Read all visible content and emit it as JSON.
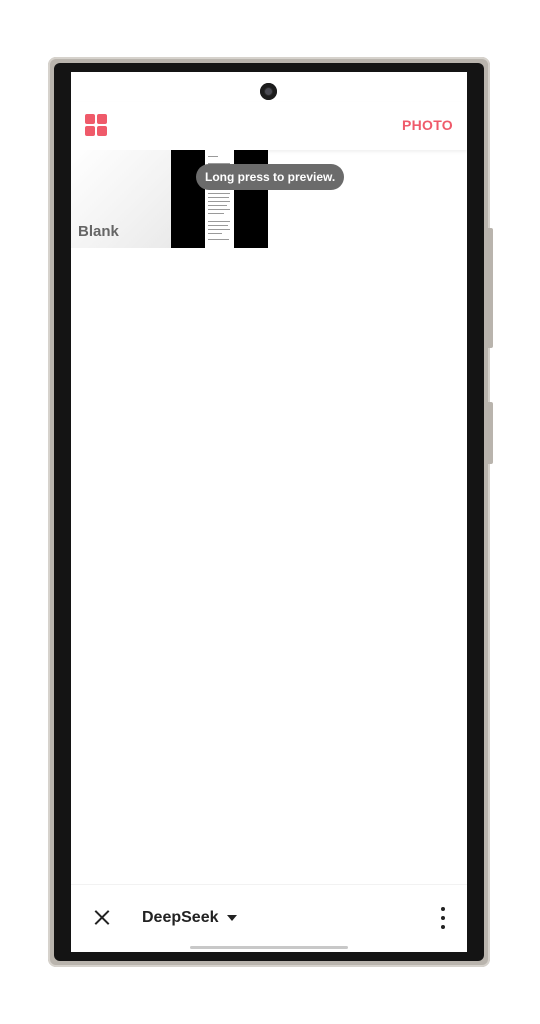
{
  "header": {
    "menu_icon": "grid-icon",
    "photo_label": "PHOTO",
    "accent_color": "#ef5a6a"
  },
  "templates": [
    {
      "label": "Blank"
    },
    {
      "label": ""
    }
  ],
  "toast": {
    "text": "Long press to preview."
  },
  "bottom_bar": {
    "close_icon": "close-icon",
    "model_label": "DeepSeek",
    "dropdown_icon": "caret-down-icon",
    "more_icon": "more-vertical-icon"
  }
}
